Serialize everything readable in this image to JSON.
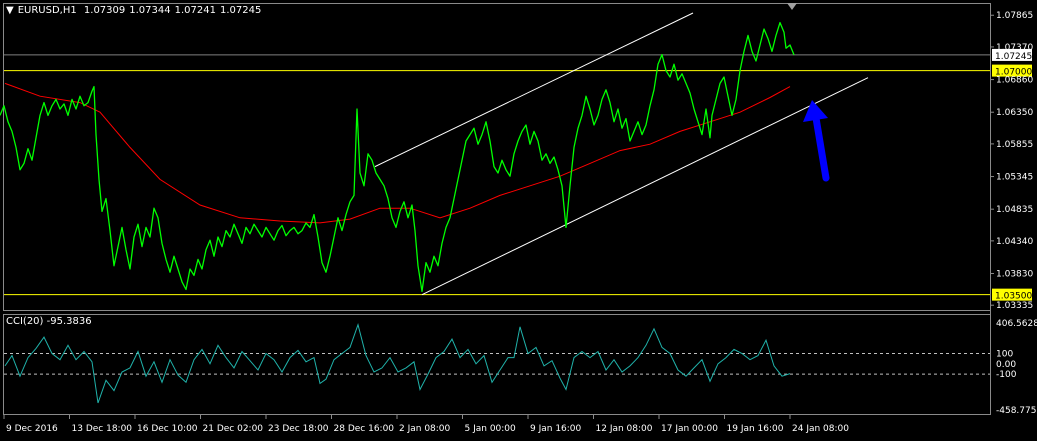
{
  "header": {
    "menu_glyph": "▼",
    "symbol": "EURUSD,H1",
    "open": "1.07309",
    "high": "1.07344",
    "low": "1.07241",
    "close": "1.07245"
  },
  "indicator": {
    "label": "CCI(20) -95.3836"
  },
  "colors": {
    "background": "#000000",
    "price_line": "#00ff00",
    "moving_average": "#ff0000",
    "cci_line": "#20b2aa",
    "channel": "#ffffff",
    "horizontal_levels": "#ffff00",
    "arrow": "#0000ff"
  },
  "icons": {
    "annotation": "blue-arrow-icon"
  },
  "chart_data": {
    "type": "line",
    "price_axis": {
      "ticks": [
        "1.07865",
        "1.07370",
        "1.06860",
        "1.06350",
        "1.05855",
        "1.05345",
        "1.04835",
        "1.04340",
        "1.03830",
        "1.03335"
      ],
      "current_price_label": "1.07245",
      "range": [
        1.0326,
        1.079
      ]
    },
    "cci_axis": {
      "ticks": [
        "406.5628",
        "100",
        "0.00",
        "-100",
        "-458.7756"
      ],
      "range": [
        -458.7756,
        406.5628
      ],
      "levels": [
        100,
        -100
      ]
    },
    "time_axis": {
      "labels": [
        "9 Dec 2016",
        "13 Dec 18:00",
        "16 Dec 10:00",
        "21 Dec 02:00",
        "23 Dec 18:00",
        "28 Dec 16:00",
        "2 Jan 08:00",
        "5 Jan 00:00",
        "9 Jan 16:00",
        "12 Jan 08:00",
        "17 Jan 00:00",
        "19 Jan 16:00",
        "24 Jan 08:00"
      ]
    },
    "horizontal_levels": [
      {
        "label": "1.07000",
        "value": 1.07
      },
      {
        "label": "1.03500",
        "value": 1.035
      }
    ],
    "price_points": [
      [
        0,
        1.063
      ],
      [
        4,
        1.0645
      ],
      [
        8,
        1.062
      ],
      [
        12,
        1.0605
      ],
      [
        16,
        1.058
      ],
      [
        20,
        1.0545
      ],
      [
        24,
        1.0555
      ],
      [
        28,
        1.0578
      ],
      [
        32,
        1.056
      ],
      [
        36,
        1.0595
      ],
      [
        40,
        1.063
      ],
      [
        44,
        1.065
      ],
      [
        48,
        1.063
      ],
      [
        52,
        1.0645
      ],
      [
        56,
        1.0655
      ],
      [
        60,
        1.064
      ],
      [
        64,
        1.0648
      ],
      [
        68,
        1.063
      ],
      [
        72,
        1.0655
      ],
      [
        76,
        1.064
      ],
      [
        80,
        1.066
      ],
      [
        84,
        1.0645
      ],
      [
        88,
        1.065
      ],
      [
        92,
        1.0668
      ],
      [
        94,
        1.0675
      ],
      [
        96,
        1.06
      ],
      [
        99,
        1.053
      ],
      [
        102,
        1.048
      ],
      [
        106,
        1.05
      ],
      [
        110,
        1.045
      ],
      [
        114,
        1.0395
      ],
      [
        118,
        1.0425
      ],
      [
        122,
        1.0455
      ],
      [
        126,
        1.042
      ],
      [
        130,
        1.039
      ],
      [
        134,
        1.044
      ],
      [
        138,
        1.046
      ],
      [
        142,
        1.0425
      ],
      [
        146,
        1.0455
      ],
      [
        150,
        1.044
      ],
      [
        154,
        1.0485
      ],
      [
        158,
        1.047
      ],
      [
        162,
        1.043
      ],
      [
        166,
        1.0405
      ],
      [
        170,
        1.0385
      ],
      [
        174,
        1.041
      ],
      [
        178,
        1.039
      ],
      [
        182,
        1.037
      ],
      [
        186,
        1.0358
      ],
      [
        190,
        1.039
      ],
      [
        194,
        1.038
      ],
      [
        198,
        1.0405
      ],
      [
        202,
        1.039
      ],
      [
        206,
        1.042
      ],
      [
        210,
        1.0435
      ],
      [
        214,
        1.041
      ],
      [
        218,
        1.044
      ],
      [
        222,
        1.0425
      ],
      [
        226,
        1.045
      ],
      [
        230,
        1.044
      ],
      [
        234,
        1.046
      ],
      [
        238,
        1.0445
      ],
      [
        242,
        1.043
      ],
      [
        246,
        1.0455
      ],
      [
        250,
        1.0445
      ],
      [
        254,
        1.046
      ],
      [
        258,
        1.045
      ],
      [
        262,
        1.044
      ],
      [
        266,
        1.0455
      ],
      [
        270,
        1.0445
      ],
      [
        274,
        1.0435
      ],
      [
        278,
        1.045
      ],
      [
        282,
        1.0458
      ],
      [
        286,
        1.0442
      ],
      [
        290,
        1.045
      ],
      [
        294,
        1.0455
      ],
      [
        298,
        1.0445
      ],
      [
        302,
        1.045
      ],
      [
        306,
        1.0462
      ],
      [
        310,
        1.0455
      ],
      [
        314,
        1.0475
      ],
      [
        318,
        1.044
      ],
      [
        322,
        1.04
      ],
      [
        326,
        1.0385
      ],
      [
        330,
        1.041
      ],
      [
        334,
        1.044
      ],
      [
        338,
        1.047
      ],
      [
        342,
        1.045
      ],
      [
        346,
        1.0475
      ],
      [
        350,
        1.0495
      ],
      [
        354,
        1.0505
      ],
      [
        357,
        1.064
      ],
      [
        360,
        1.054
      ],
      [
        364,
        1.052
      ],
      [
        368,
        1.057
      ],
      [
        372,
        1.056
      ],
      [
        376,
        1.054
      ],
      [
        380,
        1.053
      ],
      [
        384,
        1.052
      ],
      [
        388,
        1.05
      ],
      [
        392,
        1.047
      ],
      [
        396,
        1.0455
      ],
      [
        400,
        1.048
      ],
      [
        404,
        1.0495
      ],
      [
        408,
        1.047
      ],
      [
        412,
        1.049
      ],
      [
        415,
        1.045
      ],
      [
        418,
        1.0395
      ],
      [
        422,
        1.0355
      ],
      [
        426,
        1.04
      ],
      [
        430,
        1.0385
      ],
      [
        434,
        1.041
      ],
      [
        438,
        1.0395
      ],
      [
        442,
        1.043
      ],
      [
        446,
        1.0455
      ],
      [
        450,
        1.047
      ],
      [
        454,
        1.05
      ],
      [
        458,
        1.053
      ],
      [
        462,
        1.056
      ],
      [
        466,
        1.059
      ],
      [
        470,
        1.06
      ],
      [
        474,
        1.061
      ],
      [
        478,
        1.0585
      ],
      [
        482,
        1.06
      ],
      [
        486,
        1.062
      ],
      [
        490,
        1.059
      ],
      [
        494,
        1.055
      ],
      [
        498,
        1.054
      ],
      [
        502,
        1.056
      ],
      [
        506,
        1.0545
      ],
      [
        510,
        1.0535
      ],
      [
        514,
        1.057
      ],
      [
        518,
        1.059
      ],
      [
        522,
        1.0605
      ],
      [
        526,
        1.0615
      ],
      [
        530,
        1.0585
      ],
      [
        534,
        1.0605
      ],
      [
        538,
        1.059
      ],
      [
        542,
        1.056
      ],
      [
        546,
        1.057
      ],
      [
        550,
        1.0555
      ],
      [
        554,
        1.0565
      ],
      [
        558,
        1.0545
      ],
      [
        562,
        1.052
      ],
      [
        566,
        1.0455
      ],
      [
        570,
        1.052
      ],
      [
        574,
        1.058
      ],
      [
        578,
        1.061
      ],
      [
        582,
        1.063
      ],
      [
        586,
        1.066
      ],
      [
        590,
        1.064
      ],
      [
        594,
        1.0615
      ],
      [
        598,
        1.063
      ],
      [
        602,
        1.0655
      ],
      [
        606,
        1.067
      ],
      [
        610,
        1.065
      ],
      [
        614,
        1.062
      ],
      [
        618,
        1.064
      ],
      [
        622,
        1.061
      ],
      [
        626,
        1.0625
      ],
      [
        630,
        1.059
      ],
      [
        634,
        1.0605
      ],
      [
        638,
        1.062
      ],
      [
        642,
        1.06
      ],
      [
        646,
        1.0615
      ],
      [
        650,
        1.0645
      ],
      [
        654,
        1.067
      ],
      [
        658,
        1.071
      ],
      [
        662,
        1.0725
      ],
      [
        666,
        1.07
      ],
      [
        670,
        1.069
      ],
      [
        674,
        1.071
      ],
      [
        678,
        1.0685
      ],
      [
        682,
        1.0695
      ],
      [
        686,
        1.068
      ],
      [
        690,
        1.0665
      ],
      [
        694,
        1.064
      ],
      [
        698,
        1.062
      ],
      [
        702,
        1.06
      ],
      [
        706,
        1.064
      ],
      [
        710,
        1.0595
      ],
      [
        712,
        1.063
      ],
      [
        716,
        1.0655
      ],
      [
        720,
        1.068
      ],
      [
        724,
        1.069
      ],
      [
        728,
        1.066
      ],
      [
        732,
        1.063
      ],
      [
        736,
        1.0655
      ],
      [
        740,
        1.07
      ],
      [
        744,
        1.073
      ],
      [
        748,
        1.0755
      ],
      [
        752,
        1.073
      ],
      [
        756,
        1.0715
      ],
      [
        760,
        1.074
      ],
      [
        764,
        1.0765
      ],
      [
        768,
        1.075
      ],
      [
        772,
        1.073
      ],
      [
        776,
        1.0755
      ],
      [
        780,
        1.0775
      ],
      [
        784,
        1.076
      ],
      [
        786,
        1.0735
      ],
      [
        790,
        1.074
      ],
      [
        794,
        1.07245
      ]
    ],
    "moving_average_points": [
      [
        5,
        1.068
      ],
      [
        40,
        1.066
      ],
      [
        80,
        1.065
      ],
      [
        100,
        1.0635
      ],
      [
        130,
        1.058
      ],
      [
        160,
        1.053
      ],
      [
        200,
        1.049
      ],
      [
        240,
        1.047
      ],
      [
        280,
        1.0465
      ],
      [
        320,
        1.0462
      ],
      [
        350,
        1.0468
      ],
      [
        380,
        1.0485
      ],
      [
        410,
        1.0485
      ],
      [
        440,
        1.047
      ],
      [
        470,
        1.0485
      ],
      [
        500,
        1.0505
      ],
      [
        530,
        1.052
      ],
      [
        560,
        1.0535
      ],
      [
        590,
        1.0555
      ],
      [
        620,
        1.0575
      ],
      [
        650,
        1.0585
      ],
      [
        680,
        1.0605
      ],
      [
        710,
        1.062
      ],
      [
        740,
        1.0635
      ],
      [
        770,
        1.0658
      ],
      [
        790,
        1.0675
      ]
    ],
    "channel_lines": [
      {
        "x": [
          375,
          693
        ],
        "y": [
          1.055,
          1.079
        ]
      },
      {
        "x": [
          422,
          868
        ],
        "y": [
          1.035,
          1.0689
        ]
      }
    ],
    "cci_points": [
      [
        5,
        -20
      ],
      [
        12,
        80
      ],
      [
        20,
        -120
      ],
      [
        28,
        60
      ],
      [
        36,
        150
      ],
      [
        44,
        260
      ],
      [
        52,
        100
      ],
      [
        60,
        40
      ],
      [
        68,
        180
      ],
      [
        76,
        40
      ],
      [
        84,
        120
      ],
      [
        92,
        20
      ],
      [
        98,
        -380
      ],
      [
        106,
        -160
      ],
      [
        114,
        -260
      ],
      [
        122,
        -80
      ],
      [
        130,
        -40
      ],
      [
        138,
        120
      ],
      [
        146,
        -120
      ],
      [
        154,
        20
      ],
      [
        162,
        -180
      ],
      [
        170,
        40
      ],
      [
        178,
        -110
      ],
      [
        186,
        -180
      ],
      [
        194,
        40
      ],
      [
        202,
        140
      ],
      [
        210,
        0
      ],
      [
        218,
        180
      ],
      [
        226,
        60
      ],
      [
        234,
        -40
      ],
      [
        242,
        120
      ],
      [
        250,
        30
      ],
      [
        258,
        -60
      ],
      [
        266,
        100
      ],
      [
        274,
        40
      ],
      [
        282,
        -80
      ],
      [
        290,
        60
      ],
      [
        298,
        130
      ],
      [
        306,
        20
      ],
      [
        314,
        60
      ],
      [
        320,
        -190
      ],
      [
        326,
        -150
      ],
      [
        334,
        40
      ],
      [
        342,
        100
      ],
      [
        350,
        160
      ],
      [
        358,
        380
      ],
      [
        366,
        80
      ],
      [
        374,
        -80
      ],
      [
        382,
        -40
      ],
      [
        390,
        60
      ],
      [
        398,
        -80
      ],
      [
        406,
        -40
      ],
      [
        414,
        20
      ],
      [
        420,
        -250
      ],
      [
        428,
        -100
      ],
      [
        436,
        60
      ],
      [
        444,
        120
      ],
      [
        452,
        240
      ],
      [
        460,
        60
      ],
      [
        468,
        140
      ],
      [
        476,
        0
      ],
      [
        484,
        80
      ],
      [
        492,
        -180
      ],
      [
        500,
        -60
      ],
      [
        508,
        60
      ],
      [
        514,
        60
      ],
      [
        520,
        360
      ],
      [
        528,
        100
      ],
      [
        536,
        160
      ],
      [
        544,
        -20
      ],
      [
        552,
        30
      ],
      [
        560,
        -140
      ],
      [
        566,
        -250
      ],
      [
        574,
        60
      ],
      [
        582,
        120
      ],
      [
        590,
        60
      ],
      [
        598,
        120
      ],
      [
        606,
        -60
      ],
      [
        614,
        40
      ],
      [
        622,
        -80
      ],
      [
        630,
        -20
      ],
      [
        638,
        60
      ],
      [
        646,
        180
      ],
      [
        654,
        340
      ],
      [
        662,
        160
      ],
      [
        670,
        100
      ],
      [
        678,
        -60
      ],
      [
        686,
        -120
      ],
      [
        694,
        -40
      ],
      [
        702,
        40
      ],
      [
        710,
        -170
      ],
      [
        718,
        0
      ],
      [
        726,
        60
      ],
      [
        734,
        140
      ],
      [
        742,
        100
      ],
      [
        750,
        40
      ],
      [
        758,
        80
      ],
      [
        766,
        230
      ],
      [
        774,
        -20
      ],
      [
        782,
        -120
      ],
      [
        790,
        -95
      ]
    ]
  }
}
